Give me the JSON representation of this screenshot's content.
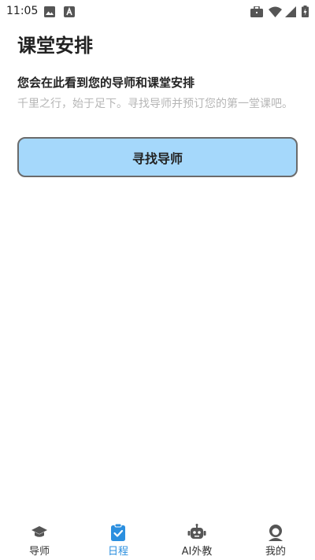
{
  "status_bar": {
    "time": "11:05",
    "left_icons": [
      "image-icon",
      "a-letter-icon"
    ],
    "right_icons": [
      "briefcase-icon",
      "wifi-icon",
      "signal-icon",
      "battery-charging-icon"
    ]
  },
  "page": {
    "title": "课堂安排",
    "subtitle": "您会在此看到您的导师和课堂安排",
    "description": "千里之行，始于足下。寻找导师并预订您的第一堂课吧。",
    "find_tutor_button": "寻找导师"
  },
  "tab_bar": {
    "active_color": "#2b8fdf",
    "items": [
      {
        "label": "导师",
        "icon": "graduation-cap-icon",
        "active": false
      },
      {
        "label": "日程",
        "icon": "clipboard-check-icon",
        "active": true
      },
      {
        "label": "AI外教",
        "icon": "robot-icon",
        "active": false
      },
      {
        "label": "我的",
        "icon": "user-icon",
        "active": false
      }
    ]
  },
  "colors": {
    "button_bg": "#a5d8fb",
    "button_border": "#6b6b6b",
    "muted_text": "#b6b6b6"
  }
}
